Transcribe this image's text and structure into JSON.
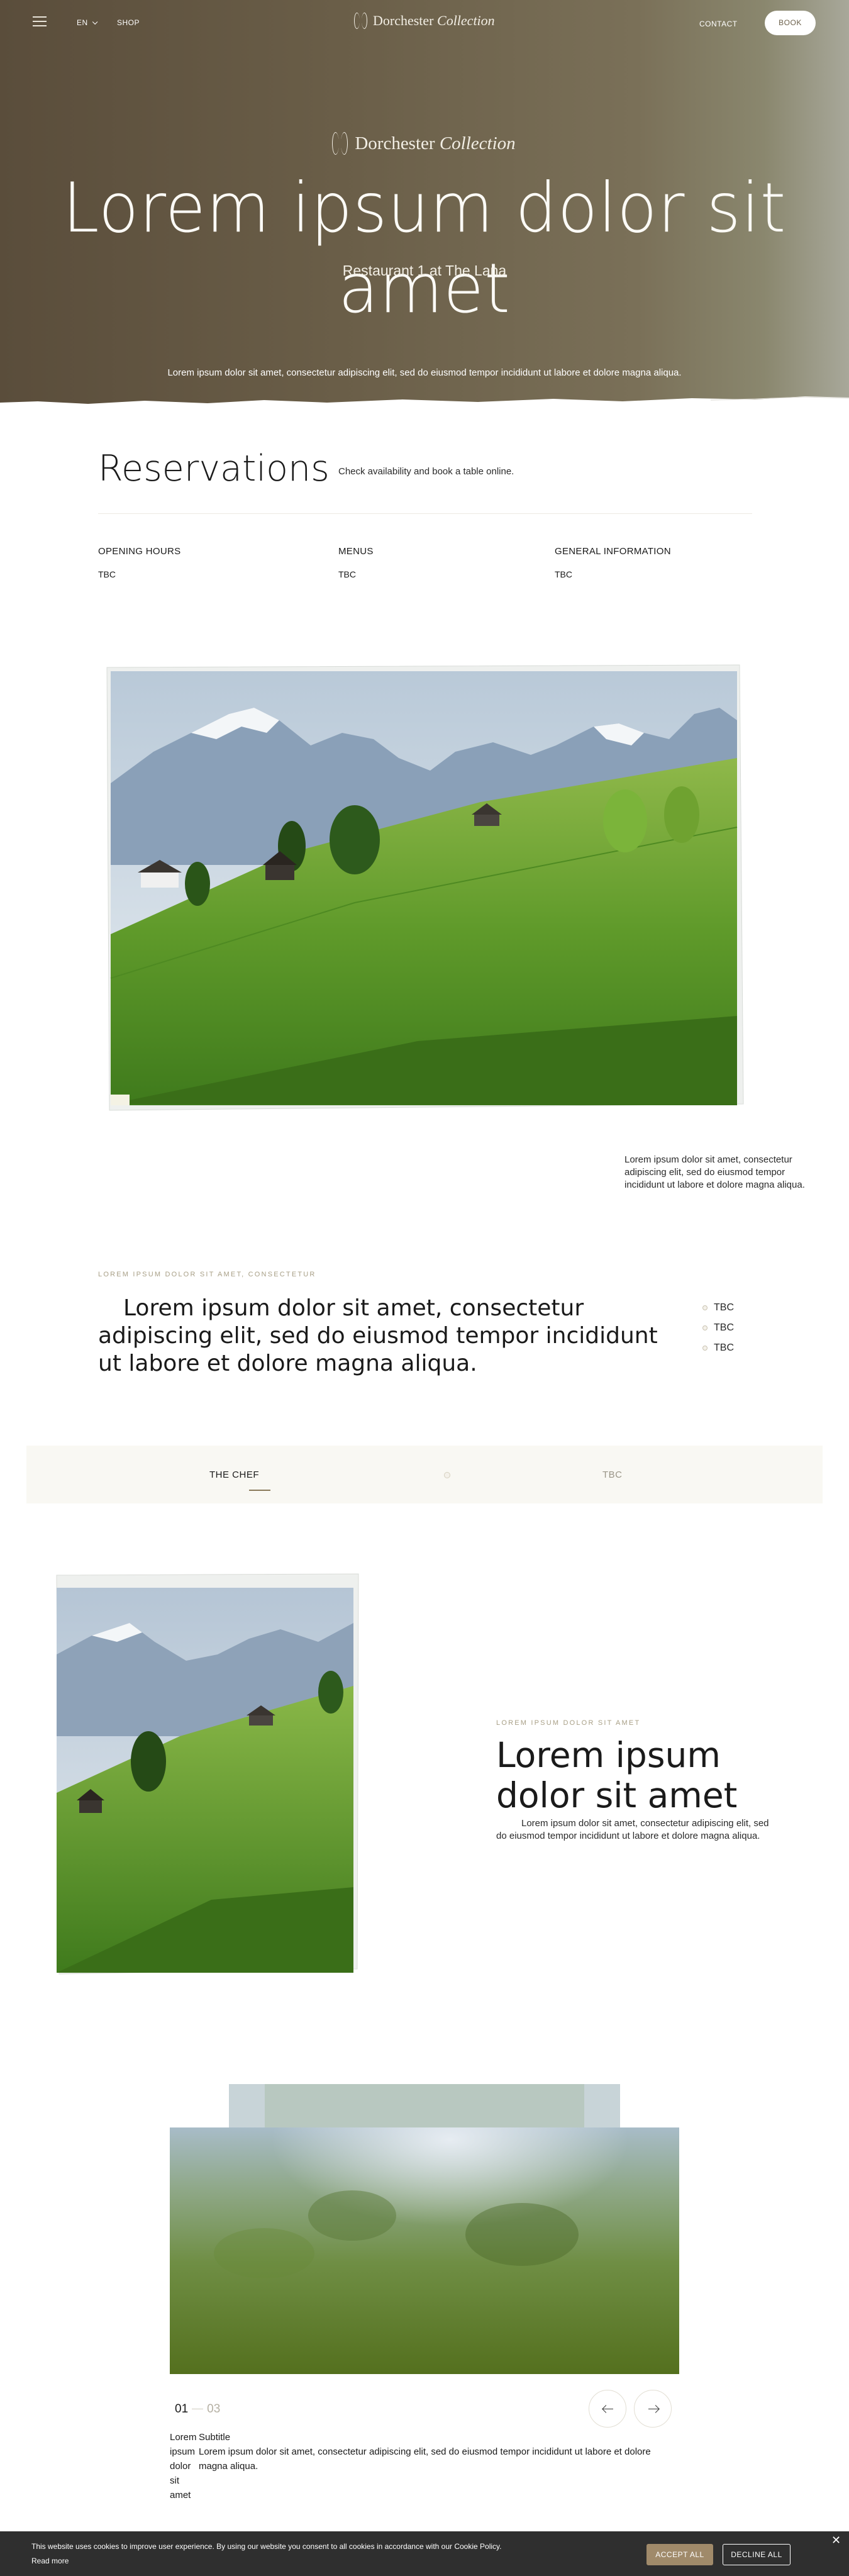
{
  "nav": {
    "language": "EN",
    "shop": "SHOP",
    "brand_main": "Dorchester",
    "brand_italic": "Collection",
    "contact": "CONTACT",
    "book": "BOOK"
  },
  "hero": {
    "brand_main": "Dorchester",
    "brand_italic": "Collection",
    "title": "Lorem ipsum dolor sit amet",
    "subtitle": "Restaurant 1 at The Lana",
    "description": "Lorem ipsum dolor sit amet, consectetur adipiscing elit, sed do eiusmod tempor incididunt ut labore et dolore magna aliqua."
  },
  "reservations": {
    "title": "Reservations",
    "description": "Check availability and book a table online.",
    "columns": [
      {
        "heading": "OPENING HOURS",
        "value": "TBC"
      },
      {
        "heading": "MENUS",
        "value": "TBC"
      },
      {
        "heading": "GENERAL INFORMATION",
        "value": "TBC"
      }
    ]
  },
  "feature": {
    "side_text": "Lorem ipsum dolor sit amet, consectetur adipiscing elit, sed do eiusmod tempor incididunt ut labore et dolore magna aliqua."
  },
  "quote_section": {
    "eyebrow": "LOREM IPSUM DOLOR SIT AMET, CONSECTETUR",
    "quote": "Lorem ipsum dolor sit amet, consectetur adipiscing elit, sed do eiusmod tempor incididunt ut labore et dolore magna aliqua.",
    "list": [
      "TBC",
      "TBC",
      "TBC"
    ]
  },
  "tabs": [
    {
      "label": "THE CHEF",
      "active": true
    },
    {
      "label": "TBC",
      "active": false
    }
  ],
  "chef": {
    "eyebrow": "LOREM IPSUM DOLOR SIT AMET",
    "title_line1": "Lorem ipsum",
    "title_line2": "dolor sit amet",
    "description": "Lorem ipsum dolor sit amet, consectetur adipiscing elit, sed do eiusmod tempor incididunt ut labore et dolore magna aliqua."
  },
  "gallery": {
    "current": "01",
    "total": "03",
    "caption_label_lines": [
      "Lorem",
      "ipsum",
      "dolor",
      "sit",
      "amet"
    ],
    "caption_subtitle": "Subtitle",
    "caption_text": "Lorem ipsum dolor sit amet, consectetur adipiscing elit, sed do eiusmod tempor incididunt ut labore et dolore magna aliqua."
  },
  "cookie": {
    "message": "This website uses cookies to improve user experience. By using our website you consent to all cookies in accordance with our Cookie Policy.",
    "read_more": "Read more",
    "accept": "ACCEPT ALL",
    "decline": "DECLINE ALL",
    "close": "✕"
  },
  "colors": {
    "hero_brown": "#5a4d3b",
    "accent_gold": "#a08a6a",
    "tab_bg": "#f9f8f3",
    "cookie_bg": "#2f2f2f"
  }
}
